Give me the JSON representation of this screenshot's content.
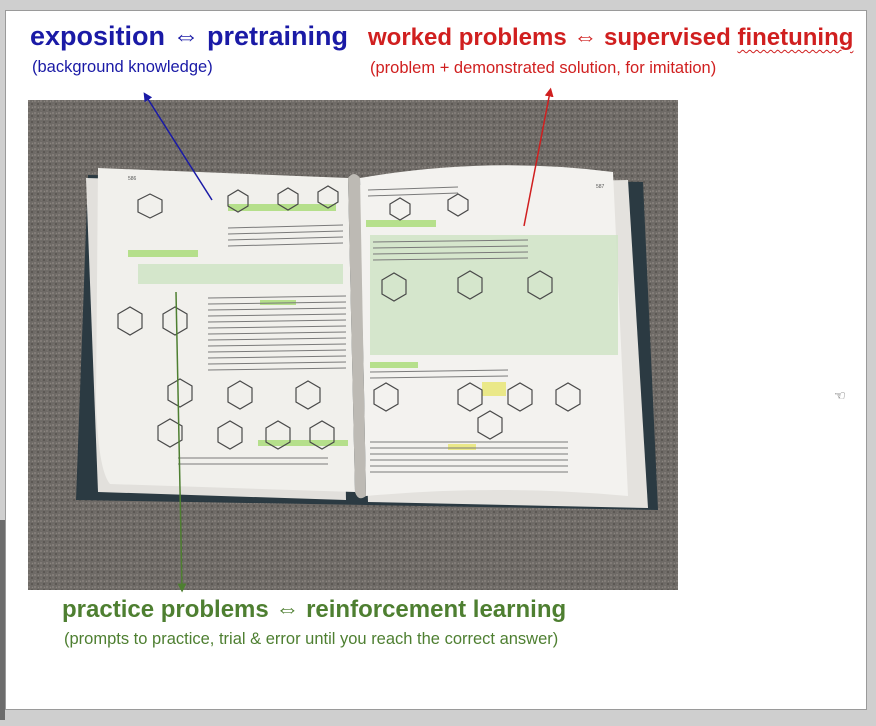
{
  "exposition": {
    "title": "exposition ⇔ pretraining",
    "subtitle": "(background knowledge)",
    "color": "#1a1aa6"
  },
  "worked": {
    "title_main": "worked problems ⇔ supervised ",
    "title_last": "finetuning",
    "subtitle": "(problem + demonstrated solution, for imitation)",
    "color": "#d01f1f"
  },
  "practice": {
    "title": "practice problems ⇔ reinforcement learning",
    "subtitle": "(prompts to practice, trial & error until you reach the correct answer)",
    "color": "#4e7f31"
  },
  "photo": {
    "left_page_header": "586",
    "right_page_header": "587"
  }
}
